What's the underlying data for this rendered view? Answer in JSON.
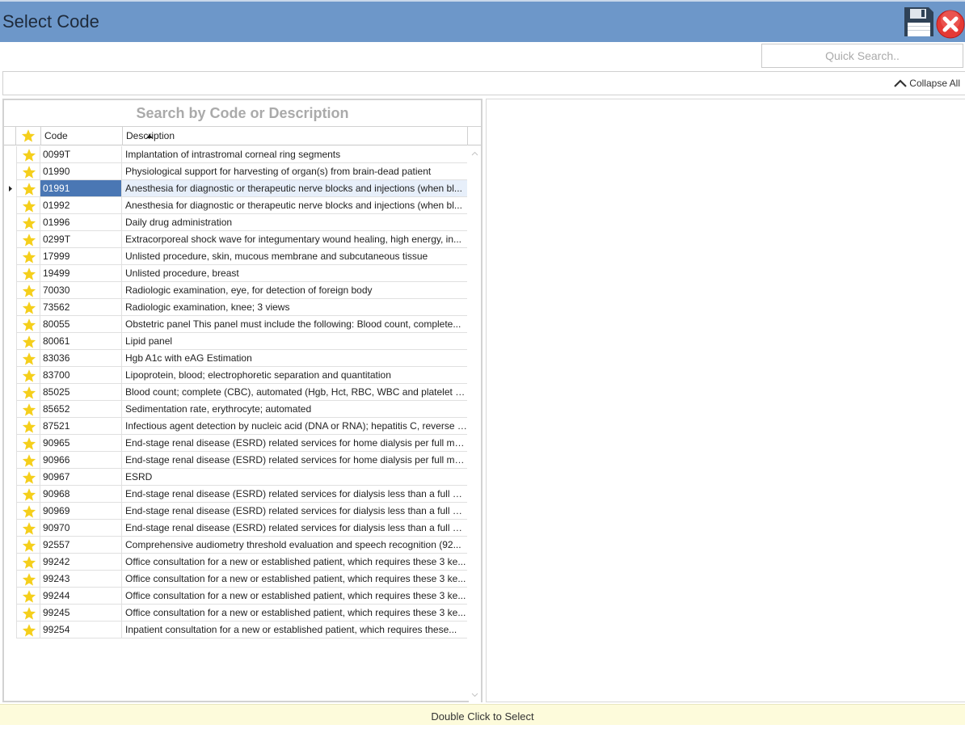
{
  "window": {
    "title": "Select Code"
  },
  "toolbar": {
    "save_icon": "floppy-disk-icon",
    "close_icon": "red-x-icon"
  },
  "quick_search": {
    "placeholder": "Quick Search..",
    "value": ""
  },
  "collapse": {
    "label": "Collapse All",
    "icon": "chevron-up-icon"
  },
  "search": {
    "placeholder": "Search by Code or Description",
    "value": ""
  },
  "grid": {
    "columns": {
      "favorite": "star-icon",
      "code": "Code",
      "description": "Description"
    },
    "sort": {
      "column": "Code",
      "direction": "ascending"
    },
    "selected_index": 2,
    "star_color": "#f5cf1b",
    "selection_color": "#4a77b4",
    "rows": [
      {
        "code": "0099T",
        "description": "Implantation of intrastromal corneal ring segments"
      },
      {
        "code": "01990",
        "description": "Physiological support for harvesting of organ(s) from brain-dead patient"
      },
      {
        "code": "01991",
        "description": "Anesthesia for diagnostic or therapeutic nerve blocks and injections (when bl..."
      },
      {
        "code": "01992",
        "description": "Anesthesia for diagnostic or therapeutic nerve blocks and injections (when bl..."
      },
      {
        "code": "01996",
        "description": "Daily drug administration"
      },
      {
        "code": "0299T",
        "description": "Extracorporeal shock wave for integumentary wound healing, high energy, in..."
      },
      {
        "code": "17999",
        "description": "Unlisted procedure, skin, mucous membrane and subcutaneous tissue"
      },
      {
        "code": "19499",
        "description": "Unlisted procedure, breast"
      },
      {
        "code": "70030",
        "description": "Radiologic examination, eye, for detection of foreign body"
      },
      {
        "code": "73562",
        "description": "Radiologic examination, knee; 3 views"
      },
      {
        "code": "80055",
        "description": "Obstetric panel This panel must include the following: Blood count, complete..."
      },
      {
        "code": "80061",
        "description": "Lipid panel"
      },
      {
        "code": "83036",
        "description": "Hgb A1c with eAG Estimation"
      },
      {
        "code": "83700",
        "description": "Lipoprotein, blood; electrophoretic separation and quantitation"
      },
      {
        "code": "85025",
        "description": "Blood count; complete (CBC), automated (Hgb, Hct, RBC, WBC and platelet co..."
      },
      {
        "code": "85652",
        "description": "Sedimentation rate, erythrocyte; automated"
      },
      {
        "code": "87521",
        "description": "Infectious agent detection by nucleic acid (DNA or RNA); hepatitis C, reverse t..."
      },
      {
        "code": "90965",
        "description": "End-stage renal disease (ESRD) related services for home dialysis per full mon..."
      },
      {
        "code": "90966",
        "description": "End-stage renal disease (ESRD) related services for home dialysis per full mon..."
      },
      {
        "code": "90967",
        "description": "ESRD"
      },
      {
        "code": "90968",
        "description": "End-stage renal disease (ESRD) related services for dialysis less than a full mo..."
      },
      {
        "code": "90969",
        "description": "End-stage renal disease (ESRD) related services for dialysis less than a full mo..."
      },
      {
        "code": "90970",
        "description": "End-stage renal disease (ESRD) related services for dialysis less than a full mo..."
      },
      {
        "code": "92557",
        "description": "Comprehensive audiometry threshold evaluation and speech recognition (92..."
      },
      {
        "code": "99242",
        "description": "Office consultation for a new or established patient, which requires these 3 ke..."
      },
      {
        "code": "99243",
        "description": "Office consultation for a new or established patient, which requires these 3 ke..."
      },
      {
        "code": "99244",
        "description": "Office consultation for a new or established patient, which requires these 3 ke..."
      },
      {
        "code": "99245",
        "description": "Office consultation for a new or established patient, which requires these 3 ke..."
      },
      {
        "code": "99254",
        "description": "Inpatient consultation for a new or established patient, which requires these..."
      }
    ]
  },
  "status": {
    "text": "Double Click to Select"
  }
}
